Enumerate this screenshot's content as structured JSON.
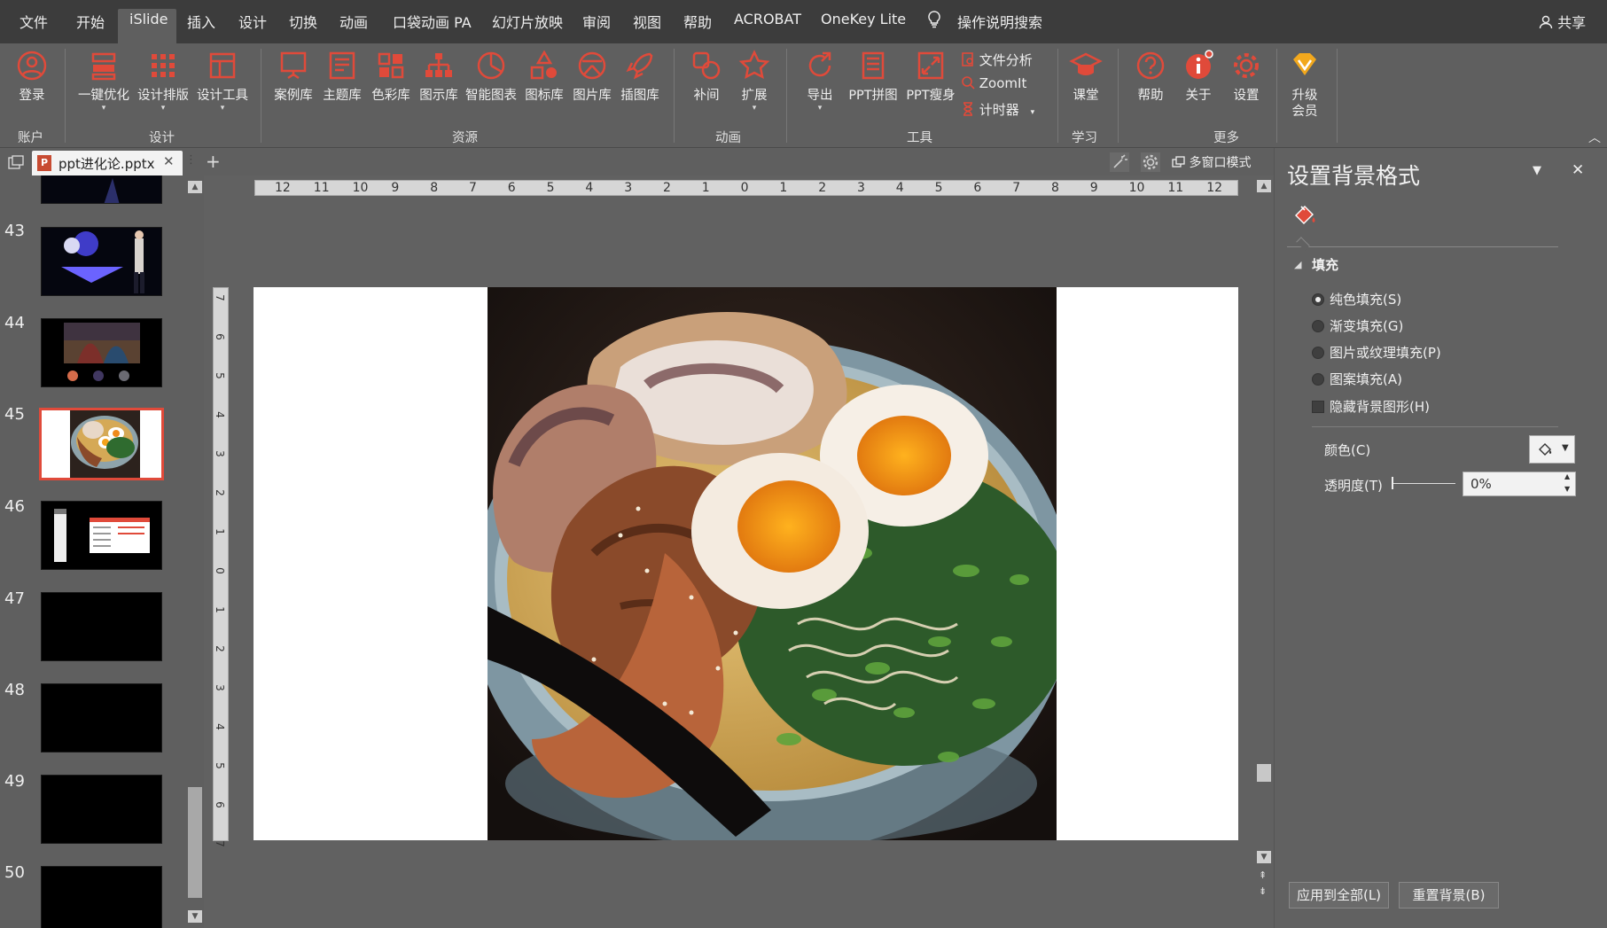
{
  "menubar": {
    "items": [
      "文件",
      "开始",
      "iSlide",
      "插入",
      "设计",
      "切换",
      "动画",
      "口袋动画 PA",
      "幻灯片放映",
      "审阅",
      "视图",
      "帮助",
      "ACROBAT",
      "OneKey Lite"
    ],
    "search_label": "操作说明搜索",
    "share_label": "共享"
  },
  "ribbon": {
    "buttons": [
      "登录",
      "一键优化",
      "设计排版",
      "设计工具",
      "案例库",
      "主题库",
      "色彩库",
      "图示库",
      "智能图表",
      "图标库",
      "图片库",
      "插图库",
      "补间",
      "扩展",
      "导出",
      "PPT拼图",
      "PPT瘦身",
      "课堂",
      "帮助",
      "关于",
      "设置",
      "升级",
      "会员"
    ],
    "small_buttons": [
      "文件分析",
      "ZoomIt",
      "计时器"
    ],
    "groups": [
      "账户",
      "设计",
      "资源",
      "动画",
      "工具",
      "学习",
      "更多"
    ]
  },
  "tabbar": {
    "doc_tab": "ppt进化论.pptx",
    "add_tab": "+",
    "multiwindow": "多窗口模式"
  },
  "thumbnails": {
    "numbers": [
      "43",
      "44",
      "45",
      "46",
      "47",
      "48",
      "49",
      "50"
    ],
    "selected": "45"
  },
  "ruler": {
    "h_ticks": [
      "12",
      "11",
      "10",
      "9",
      "8",
      "7",
      "6",
      "5",
      "4",
      "3",
      "2",
      "1",
      "0",
      "1",
      "2",
      "3",
      "4",
      "5",
      "6",
      "7",
      "8",
      "9",
      "10",
      "11",
      "12"
    ],
    "v_ticks": [
      "7",
      "6",
      "5",
      "4",
      "3",
      "2",
      "1",
      "0",
      "1",
      "2",
      "3",
      "4",
      "5",
      "6",
      "7"
    ]
  },
  "panel": {
    "title": "设置背景格式",
    "section": "填充",
    "options": [
      "纯色填充(S)",
      "渐变填充(G)",
      "图片或纹理填充(P)",
      "图案填充(A)"
    ],
    "hide_bg": "隐藏背景图形(H)",
    "color_label": "颜色(C)",
    "transparency_label": "透明度(T)",
    "transparency_value": "0%",
    "apply_all": "应用到全部(L)",
    "reset_bg": "重置背景(B)"
  },
  "colors": {
    "accent": "#e04a3a",
    "menubar": "#3c3c3c",
    "ribbon": "#5f5f5f"
  }
}
